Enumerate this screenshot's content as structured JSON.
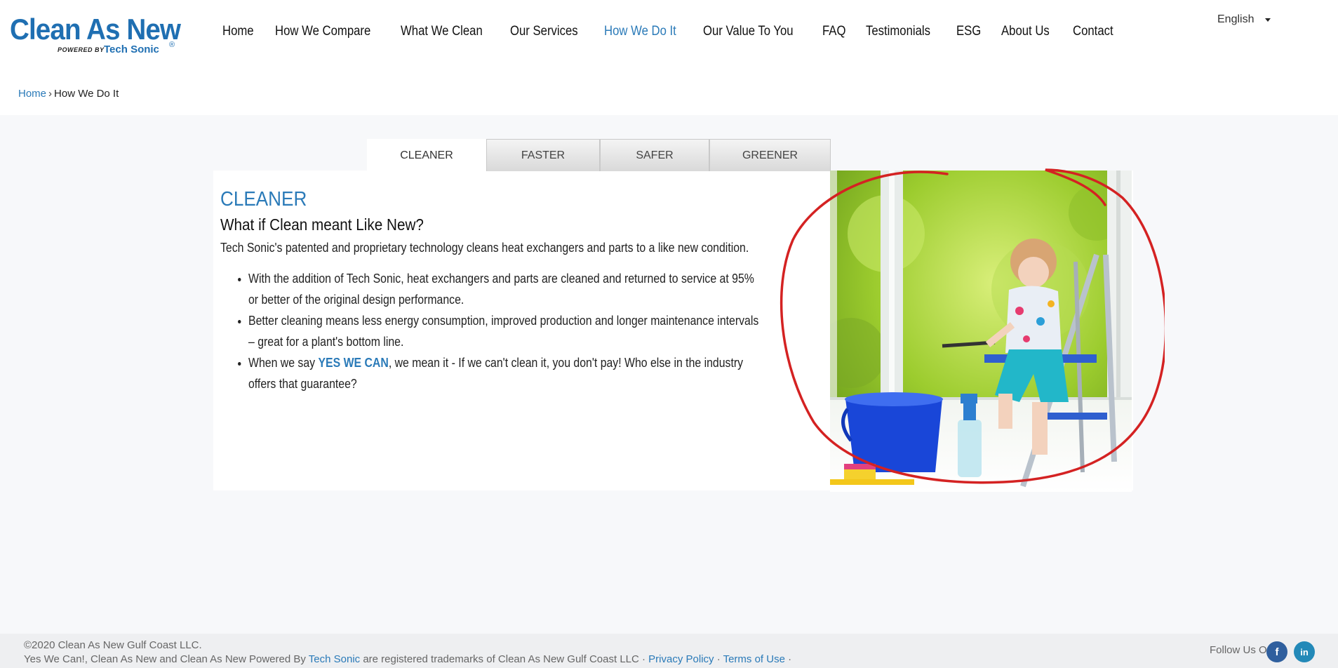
{
  "brand": {
    "name": "Clean As New",
    "powered_by": "POWERED BY",
    "sub": "Tech Sonic",
    "reg": "®",
    "accent_color": "#1f6fb2"
  },
  "nav": {
    "items": [
      {
        "label": "Home"
      },
      {
        "label": "How We Compare"
      },
      {
        "label": "What We Clean"
      },
      {
        "label": "Our Services"
      },
      {
        "label": "How We Do It"
      },
      {
        "label": "Our Value To You"
      },
      {
        "label": "FAQ"
      },
      {
        "label": "Testimonials"
      },
      {
        "label": "ESG"
      },
      {
        "label": "About Us"
      },
      {
        "label": "Contact"
      }
    ],
    "active": "How We Do It"
  },
  "language": {
    "selected": "English",
    "icon": "caret-down-icon"
  },
  "breadcrumb": {
    "home": "Home",
    "separator": "›",
    "current": "How We Do It"
  },
  "tabs": [
    {
      "label": "CLEANER"
    },
    {
      "label": "FASTER"
    },
    {
      "label": "SAFER"
    },
    {
      "label": "GREENER"
    }
  ],
  "content": {
    "heading": "CLEANER",
    "subheading": "What if Clean meant Like New?",
    "intro": "Tech Sonic's patented and proprietary technology cleans heat exchangers and parts to a like new condition.",
    "bullets": [
      {
        "text": "With the addition of Tech Sonic, heat exchangers and parts are cleaned and returned to service at 95% or better of the original design performance."
      },
      {
        "text": "Better cleaning means less energy consumption, improved production and longer maintenance intervals – great for a plant's bottom line."
      },
      {
        "prefix": "When we say ",
        "strong": "YES WE CAN",
        "suffix": ", we mean it - If we can't clean it, you don't pay! Who else in the industry offers that guarantee?"
      }
    ]
  },
  "footer": {
    "copyright": "©2020 Clean As New Gulf Coast LLC.",
    "tm_prefix": "Yes We Can!, Clean As New and Clean As New Powered By ",
    "tm_link": "Tech Sonic",
    "tm_suffix": " are registered trademarks of Clean As New Gulf Coast LLC · ",
    "privacy": "Privacy Policy",
    "sep": " · ",
    "terms": "Terms of Use",
    "trail": " ·",
    "follow_label": "Follow Us On:",
    "facebook_icon": "facebook-icon",
    "linkedin_icon": "linkedin-icon"
  }
}
